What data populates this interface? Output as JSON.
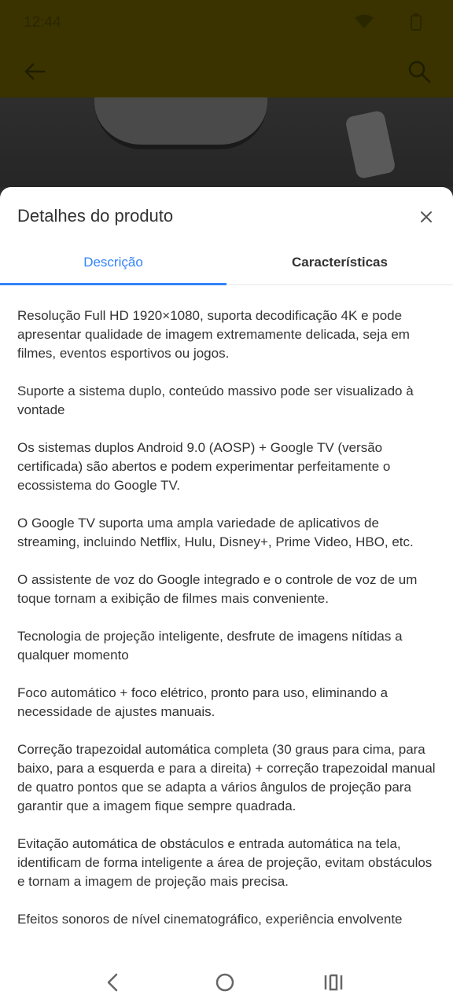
{
  "status_bar": {
    "time": "12:44"
  },
  "sheet": {
    "title": "Detalhes do produto",
    "tabs": [
      {
        "label": "Descrição",
        "active": true
      },
      {
        "label": "Características",
        "active": false
      }
    ],
    "paragraphs": [
      "Resolução Full HD 1920×1080, suporta decodificação 4K e pode apresentar qualidade de imagem extremamente delicada, seja em filmes, eventos esportivos ou jogos.",
      "Suporte a sistema duplo, conteúdo massivo pode ser visualizado à vontade",
      "Os sistemas duplos Android 9.0 (AOSP) + Google TV (versão certificada) são abertos e podem experimentar perfeitamente o ecossistema do Google TV.",
      "O Google TV suporta uma ampla variedade de aplicativos de streaming, incluindo Netflix, Hulu, Disney+, Prime Video, HBO, etc.",
      "O assistente de voz do Google integrado e o controle de voz de um toque tornam a exibição de filmes mais conveniente.",
      "Tecnologia de projeção inteligente, desfrute de imagens nítidas a qualquer momento",
      "Foco automático + foco elétrico, pronto para uso, eliminando a necessidade de ajustes manuais.",
      "Correção trapezoidal automática completa (30 graus para cima, para baixo, para a esquerda e para a direita) + correção trapezoidal manual de quatro pontos que se adapta a vários ângulos de projeção para garantir que a imagem fique sempre quadrada.",
      "Evitação automática de obstáculos e entrada automática na tela, identificam de forma inteligente a área de projeção, evitam obstáculos e tornam a imagem de projeção mais precisa.",
      "Efeitos sonoros de nível cinematográfico, experiência envolvente"
    ]
  },
  "colors": {
    "accent": "#3483fa",
    "text": "#333333",
    "toolbar_dimmed": "#3a3300"
  },
  "icons": {
    "back": "back-arrow-icon",
    "search": "search-icon",
    "close": "close-icon",
    "nav_back": "nav-back-icon",
    "nav_home": "nav-home-icon",
    "nav_recents": "nav-recents-icon"
  }
}
